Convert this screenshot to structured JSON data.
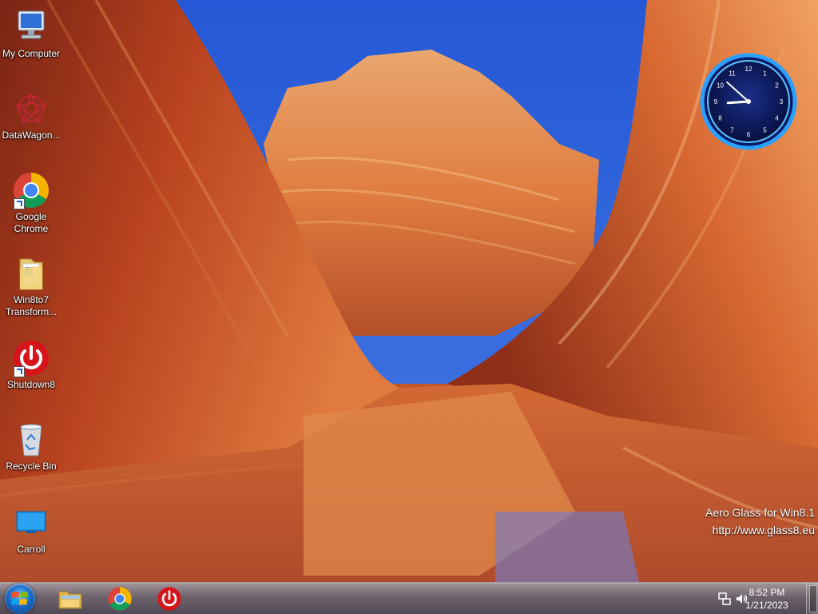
{
  "desktop": {
    "icons": [
      {
        "label": "My Computer",
        "icon": "computer-icon"
      },
      {
        "label": "DataWagon...",
        "icon": "datawagon-icon"
      },
      {
        "label": "Google Chrome",
        "icon": "chrome-icon"
      },
      {
        "label": "Win8to7 Transform...",
        "icon": "folder-icon"
      },
      {
        "label": "Shutdown8",
        "icon": "power-icon"
      },
      {
        "label": "Recycle Bin",
        "icon": "recycle-bin-icon"
      },
      {
        "label": "Carroll",
        "icon": "monitor-icon"
      }
    ]
  },
  "clock_gadget": {
    "numbers": [
      "12",
      "1",
      "2",
      "3",
      "4",
      "5",
      "6",
      "7",
      "8",
      "9",
      "10",
      "11"
    ],
    "time": "8:52"
  },
  "watermark": {
    "line1": "Aero Glass for Win8.1",
    "line2": "http://www.glass8.eu"
  },
  "taskbar": {
    "pinned": [
      {
        "name": "file-explorer",
        "icon": "file-explorer-icon"
      },
      {
        "name": "google-chrome",
        "icon": "chrome-icon"
      },
      {
        "name": "shutdown8",
        "icon": "power-icon"
      }
    ],
    "tray": {
      "time": "8:52 PM",
      "date": "1/21/2023"
    }
  },
  "colors": {
    "sky": "#1f46b3",
    "rock": "#c9582a",
    "clock_glow": "#2aa0ff",
    "shutdown_red": "#d8141b"
  }
}
